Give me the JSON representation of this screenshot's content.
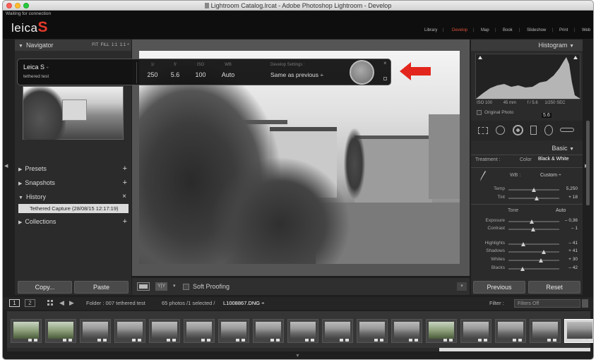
{
  "window": {
    "title": "Lightroom Catalog.lrcat - Adobe Photoshop Lightroom - Develop"
  },
  "identity": {
    "status": "Waiting for connection",
    "logo_text": "leica",
    "logo_mark": "S"
  },
  "modules": [
    "Library",
    "Develop",
    "Map",
    "Book",
    "Slideshow",
    "Print",
    "Web"
  ],
  "active_module": "Develop",
  "left_panel": {
    "navigator": {
      "title": "Navigator",
      "zoom_options": [
        "FIT",
        "FILL",
        "1:1",
        "1:1 ÷"
      ]
    },
    "presets": "Presets",
    "snapshots": "Snapshots",
    "history": {
      "title": "History",
      "close": "×",
      "items": [
        "Tethered Capture (28/08/15 12:17:19)"
      ]
    },
    "collections": "Collections",
    "plus": "+",
    "copy_button": "Copy...",
    "paste_button": "Paste"
  },
  "tether_bar": {
    "camera": "Leica S",
    "session": "tethered test",
    "settings": [
      {
        "label": "1/",
        "value": "250"
      },
      {
        "label": "f/",
        "value": "5.6"
      },
      {
        "label": "ISO",
        "value": "100"
      },
      {
        "label": "WB",
        "value": "Auto"
      }
    ],
    "develop_label": "Develop Settings :",
    "develop_value": "Same as previous ÷",
    "close": "×"
  },
  "toolbar": {
    "view_ab": "Y|Y",
    "soft_proofing": "Soft Proofing"
  },
  "right_panel": {
    "histogram": {
      "title": "Histogram",
      "info": [
        "ISO 100",
        "45 mm",
        "f / 5.6",
        "1/250 SEC"
      ],
      "original_photo": "Original Photo",
      "badge": "5.6"
    },
    "basic": {
      "title": "Basic",
      "treatment_label": "Treatment :",
      "treatment_color": "Color",
      "treatment_bw": "Black & White",
      "wb_label": "WB :",
      "wb_value": "Custom ÷",
      "tone_label": "Tone",
      "auto_label": "Auto",
      "sliders": [
        {
          "label": "Temp",
          "value": "5,250",
          "pos": 0.5
        },
        {
          "label": "Tint",
          "value": "+ 18",
          "pos": 0.56
        },
        {
          "label": "Exposure",
          "value": "– 0,36",
          "pos": 0.46
        },
        {
          "label": "Contrast",
          "value": "– 1",
          "pos": 0.49
        },
        {
          "label": "Highlights",
          "value": "– 41",
          "pos": 0.3
        },
        {
          "label": "Shadows",
          "value": "+ 41",
          "pos": 0.7
        },
        {
          "label": "Whites",
          "value": "+ 30",
          "pos": 0.65
        },
        {
          "label": "Blacks",
          "value": "– 42",
          "pos": 0.29
        }
      ]
    },
    "previous_button": "Previous",
    "reset_button": "Reset"
  },
  "filmstrip": {
    "page1": "1",
    "page2": "2",
    "folder": "Folder : 007 tethered test",
    "count": "65 photos /1 selected /",
    "filename": "L1008867.DNG ÷",
    "filter_label": "Filter :",
    "filter_value": "Filters Off"
  }
}
